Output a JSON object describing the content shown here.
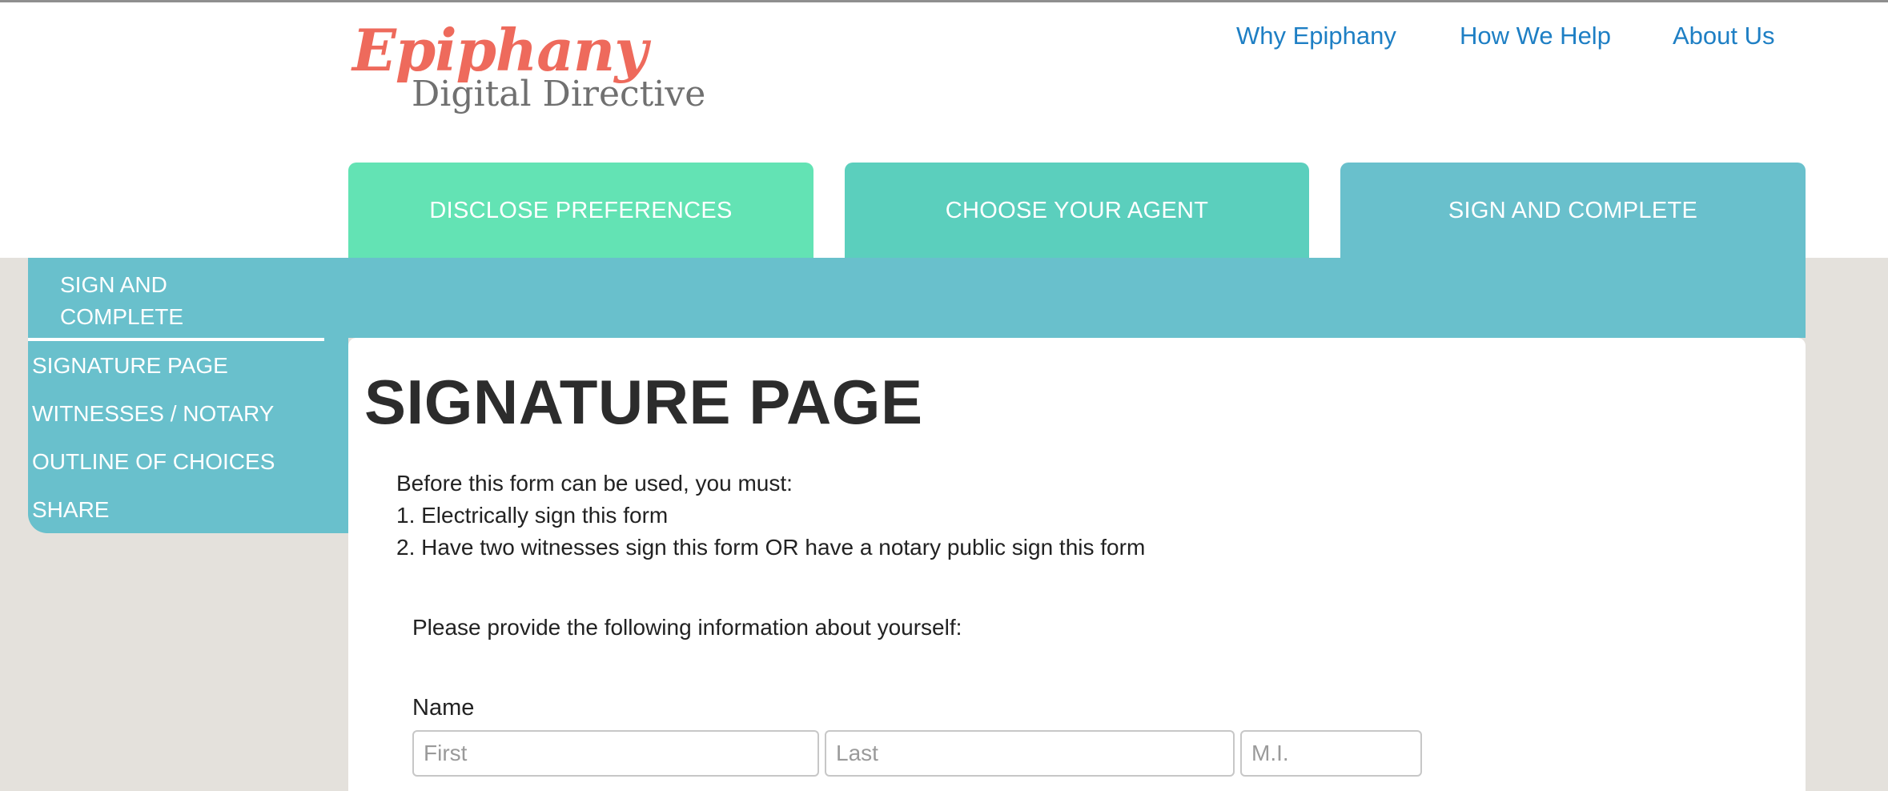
{
  "logo": {
    "script_text": "Epiphany",
    "sub_text": "Digital Directive"
  },
  "top_nav": {
    "links": [
      {
        "label": "Why Epiphany"
      },
      {
        "label": "How We Help"
      },
      {
        "label": "About Us"
      }
    ]
  },
  "steps": {
    "tabs": [
      {
        "label": "DISCLOSE PREFERENCES",
        "color": "#63e3b4"
      },
      {
        "label": "CHOOSE YOUR AGENT",
        "color": "#5bcfbd"
      },
      {
        "label": "SIGN AND COMPLETE",
        "color": "#69c0cc",
        "active": true
      }
    ]
  },
  "sidebar": {
    "title": "SIGN AND COMPLETE",
    "items": [
      {
        "label": "SIGNATURE PAGE",
        "active": true
      },
      {
        "label": "WITNESSES / NOTARY"
      },
      {
        "label": "OUTLINE OF CHOICES"
      },
      {
        "label": "SHARE"
      }
    ]
  },
  "main": {
    "heading": "SIGNATURE PAGE",
    "instructions": {
      "intro": "Before this form can be used, you must:",
      "step_one": "1. Electrically sign this form",
      "step_two": "2. Have two witnesses sign this form OR have a notary public sign this form"
    },
    "provide_text": "Please provide the following information about yourself:",
    "name_section": {
      "label": "Name",
      "first": {
        "value": "",
        "placeholder": "First"
      },
      "last": {
        "value": "",
        "placeholder": "Last"
      },
      "mi": {
        "value": "",
        "placeholder": "M.I."
      }
    }
  },
  "colors": {
    "brand_coral": "#ee6a5c",
    "link_blue": "#1e7fc4",
    "teal": "#69c0cc",
    "background_gray": "#e4e1dc"
  }
}
